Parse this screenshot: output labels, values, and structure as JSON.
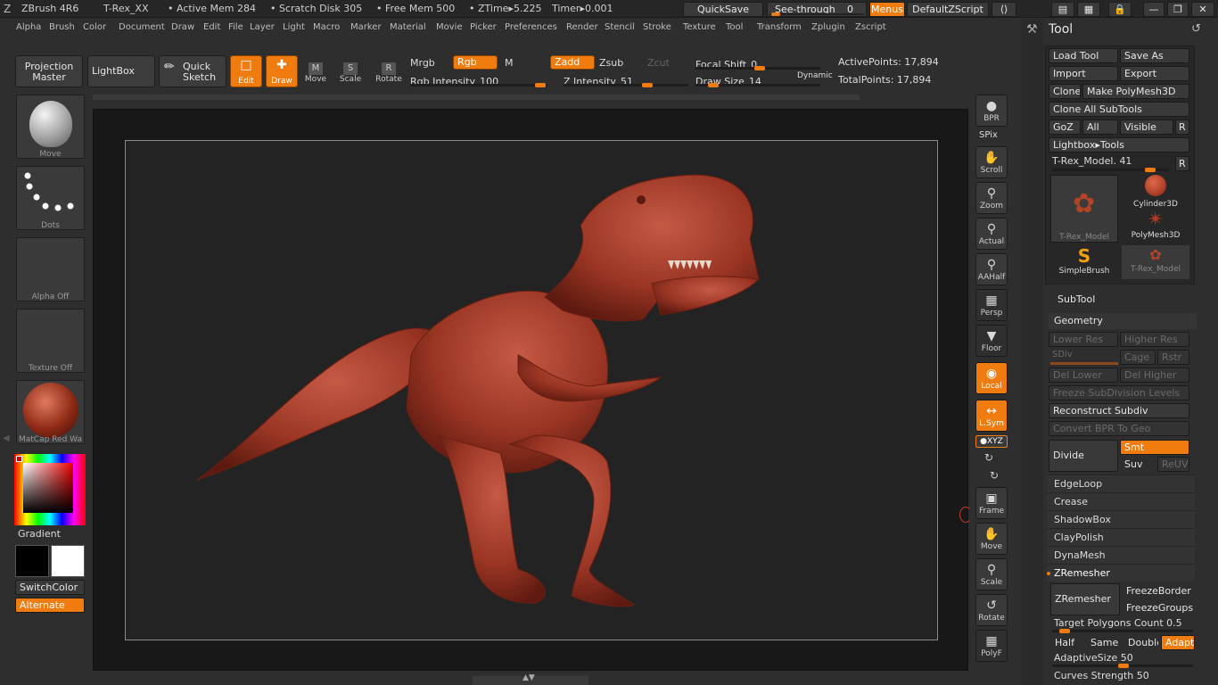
{
  "title": {
    "app": "ZBrush 4R6",
    "doc": "T-Rex_XX",
    "active_mem": "• Active Mem 284",
    "scratch": "• Scratch Disk 305",
    "free_mem": "• Free Mem 500",
    "ztime": "• ZTime▸5.225",
    "timer": "Timer▸0.001",
    "quicksave": "QuickSave",
    "seethrough": "See-through",
    "seethrough_val": "0",
    "menus": "Menus",
    "zscript": "DefaultZScript"
  },
  "menubar": [
    "Alpha",
    "Brush",
    "Color",
    "Document",
    "Draw",
    "Edit",
    "File",
    "Layer",
    "Light",
    "Macro",
    "Marker",
    "Material",
    "Movie",
    "Picker",
    "Preferences",
    "Render",
    "Stencil",
    "Stroke",
    "Texture",
    "Tool",
    "Transform",
    "Zplugin",
    "Zscript"
  ],
  "toolbar": {
    "projection_master": "Projection Master",
    "lightbox": "LightBox",
    "quick_sketch": "Quick Sketch",
    "edit": "Edit",
    "draw": "Draw",
    "move": "Move",
    "scale": "Scale",
    "rotate": "Rotate",
    "mrgb": "Mrgb",
    "rgb": "Rgb",
    "m": "M",
    "rgb_intensity_label": "Rgb Intensity",
    "rgb_intensity": "100",
    "zadd": "Zadd",
    "zsub": "Zsub",
    "zcut": "Zcut",
    "z_intensity_label": "Z Intensity",
    "z_intensity": "51",
    "focal_shift_label": "Focal Shift",
    "focal_shift": "0",
    "draw_size_label": "Draw Size",
    "draw_size": "14",
    "dynamic": "Dynamic",
    "active_points": "ActivePoints: 17,894",
    "total_points": "TotalPoints: 17,894"
  },
  "left": {
    "brush": "Move",
    "stroke": "Dots",
    "alpha": "Alpha Off",
    "texture": "Texture Off",
    "material": "MatCap Red Wa",
    "gradient": "Gradient",
    "switchcolor": "SwitchColor",
    "alternate": "Alternate"
  },
  "right": {
    "bpr": "BPR",
    "spix": "SPix",
    "scroll": "Scroll",
    "zoom": "Zoom",
    "actual": "Actual",
    "aahalf": "AAHalf",
    "persp": "Persp",
    "floor": "Floor",
    "local": "Local",
    "lsym": "L.Sym",
    "xyz": "●XYZ",
    "frame": "Frame",
    "move": "Move",
    "scale": "Scale",
    "rotate": "Rotate",
    "polyf": "PolyF"
  },
  "tool": {
    "header": "Tool",
    "load_tool": "Load Tool",
    "save_as": "Save As",
    "import": "Import",
    "export": "Export",
    "clone": "Clone",
    "make_polymesh": "Make PolyMesh3D",
    "clone_all": "Clone All SubTools",
    "goz": "GoZ",
    "all": "All",
    "visible": "Visible",
    "r": "R",
    "lightbox_tools": "Lightbox▸Tools",
    "tmodel_label": "T-Rex_Model.",
    "tmodel_val": "41",
    "thumbs": [
      "T-Rex_Model",
      "Cylinder3D",
      "PolyMesh3D",
      "SimpleBrush",
      "T-Rex_Model"
    ],
    "subtool": "SubTool",
    "geometry": "Geometry",
    "lower_res": "Lower Res",
    "higher_res": "Higher Res",
    "sdiv": "SDiv",
    "cage": "Cage",
    "rstr": "Rstr",
    "del_lower": "Del Lower",
    "del_higher": "Del Higher",
    "freeze_subdiv": "Freeze SubDivision Levels",
    "reconstruct": "Reconstruct Subdiv",
    "convert_bpr": "Convert BPR To Geo",
    "divide": "Divide",
    "smt": "Smt",
    "suv": "Suv",
    "reuv": "ReUV",
    "edgeloop": "EdgeLoop",
    "crease": "Crease",
    "shadowbox": "ShadowBox",
    "claypolish": "ClayPolish",
    "dynamesh": "DynaMesh",
    "zremesher_section": "ZRemesher",
    "zremesher_btn": "ZRemesher",
    "freezeborder": "FreezeBorder",
    "freezegroups": "FreezeGroups",
    "target_polys": "Target Polygons Count 0.5",
    "half": "Half",
    "same": "Same",
    "double": "Double",
    "adapt": "Adapt",
    "adaptive_size": "AdaptiveSize 50",
    "curves_strength": "Curves Strength 50"
  }
}
